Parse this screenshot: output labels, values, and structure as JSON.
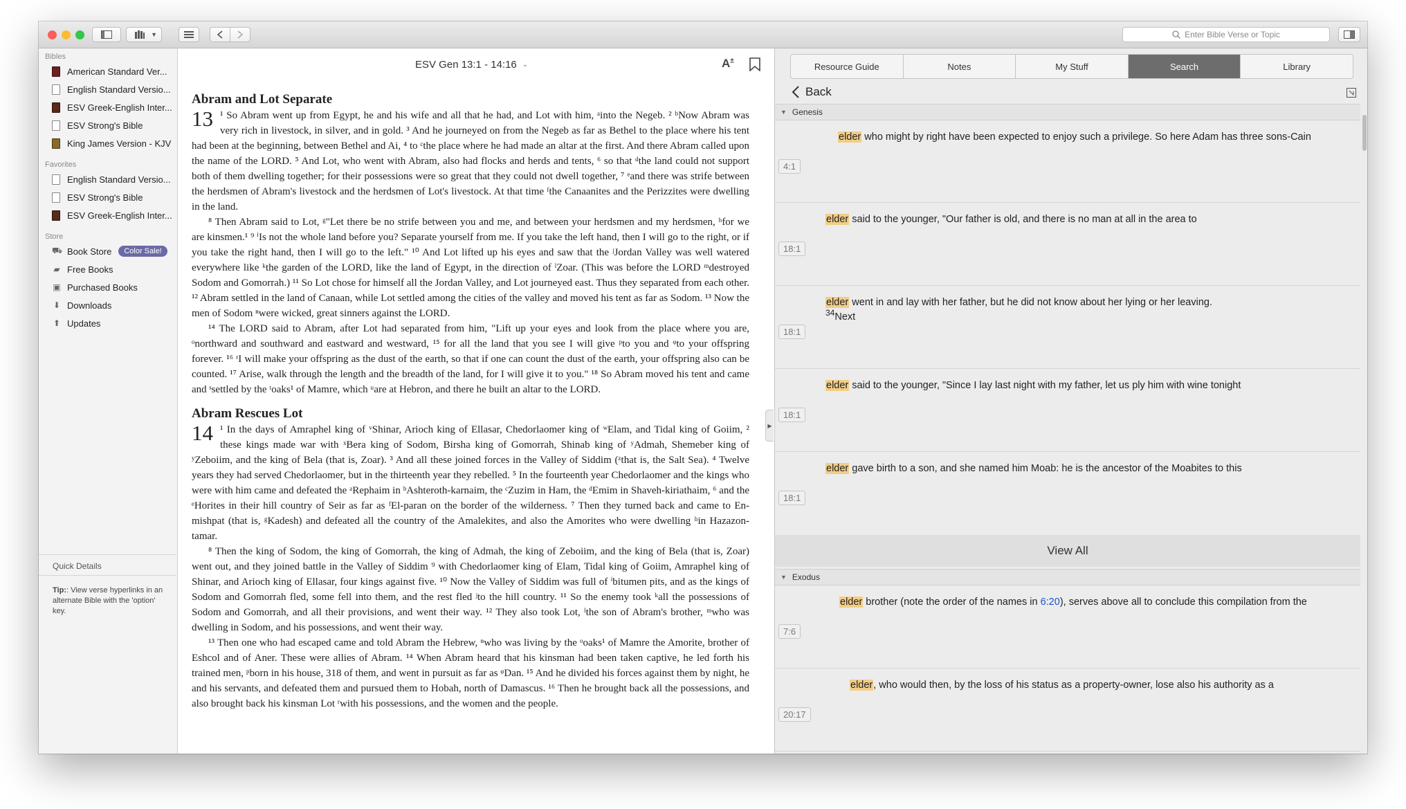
{
  "window": {
    "search_placeholder": "Enter Bible Verse or Topic",
    "traffic": [
      "#fc5f57",
      "#fdbc2e",
      "#33c748"
    ]
  },
  "sidebar": {
    "bibles_heading": "Bibles",
    "bibles": [
      {
        "label": "American Standard Ver...",
        "color": "#6e1f1f"
      },
      {
        "label": "English Standard Versio...",
        "color": "#ffffff"
      },
      {
        "label": "ESV Greek-English Inter...",
        "color": "#5a2a1a"
      },
      {
        "label": "ESV Strong's Bible",
        "color": "#ffffff"
      },
      {
        "label": "King James Version - KJV",
        "color": "#8a6a2a"
      }
    ],
    "favorites_heading": "Favorites",
    "favorites": [
      {
        "label": "English Standard Versio...",
        "color": "#ffffff"
      },
      {
        "label": "ESV Strong's Bible",
        "color": "#ffffff"
      },
      {
        "label": "ESV Greek-English Inter...",
        "color": "#5a2a1a"
      }
    ],
    "store_heading": "Store",
    "store": [
      {
        "label": "Book Store",
        "icon": "cart-icon"
      },
      {
        "label": "Free Books",
        "icon": "tag-icon"
      },
      {
        "label": "Purchased Books",
        "icon": "bag-icon"
      },
      {
        "label": "Downloads",
        "icon": "download-icon"
      },
      {
        "label": "Updates",
        "icon": "upload-icon"
      }
    ],
    "badge": "Color Sale!",
    "quick_details": "Quick Details",
    "tip_label": "Tip:",
    "tip_text": ": View verse hyperlinks in an alternate Bible with the 'option' key."
  },
  "main": {
    "reference": "ESV Gen 13:1 - 14:16",
    "heading1": "Abram and Lot Separate",
    "chapter1": "13",
    "heading2": "Abram Rescues Lot",
    "chapter2": "14"
  },
  "right": {
    "tabs": [
      "Resource Guide",
      "Notes",
      "My Stuff",
      "Search",
      "Library"
    ],
    "active_tab": "Search",
    "back_label": "Back",
    "group1": "Genesis",
    "group2": "Exodus",
    "view_all": "View All",
    "highlight_color": "#f2cd86",
    "results1": [
      {
        "hl": "elder",
        "rest": " who might by right have been expected to enjoy such a privilege. So here Adam has three sons-Cain",
        "ref": "4:1"
      },
      {
        "hl": "elder",
        "rest": " said to the younger, \"Our father is old, and there is no man at all in the area to",
        "ref": "18:1"
      },
      {
        "hl": "elder",
        "rest": " went in and lay with her father, but he did not know about her lying or her leaving.",
        "sup": "34",
        "next": "Next",
        "ref": "18:1"
      },
      {
        "hl": "elder",
        "rest": " said to the younger, \"Since I lay last night with my father, let us ply him with wine tonight",
        "ref": "18:1"
      },
      {
        "hl": "elder",
        "rest": " gave birth to a son, and she named him Moab: he is the ancestor of the Moabites to this",
        "ref": "18:1"
      }
    ],
    "results2": [
      {
        "hl": "elder",
        "pre": " brother (note the order of the names in ",
        "link": "6:20",
        "post": "), serves above all to conclude this compilation from the",
        "ref": "7:6"
      },
      {
        "hl": "elder",
        "rest": ", who would then, by the loss of his status as a property-owner, lose also his authority as a",
        "ref": "20:17"
      }
    ]
  },
  "text": {
    "p1": "¹ So Abram went up from Egypt, he and his wife and all that he had, and Lot with him, ᵃinto the Negeb. ² ᵇNow Abram was very rich in livestock, in silver, and in gold. ³ And he journeyed on from the Negeb as far as Bethel to the place where his tent had been at the beginning, between Bethel and Ai, ⁴ to ᶜthe place where he had made an altar at the first. And there Abram called upon the name of the LORD. ⁵ And Lot, who went with Abram, also had flocks and herds and tents, ⁶ so that ᵈthe land could not support both of them dwelling together; for their possessions were so great that they could not dwell together, ⁷ ᵉand there was strife between the herdsmen of Abram's livestock and the herdsmen of Lot's livestock. At that time ᶠthe Canaanites and the Perizzites were dwelling in the land.",
    "p2": "⁸ Then Abram said to Lot, ᵍ\"Let there be no strife between you and me, and between your herdsmen and my herdsmen, ʰfor we are kinsmen.¹ ⁹ ⁱIs not the whole land before you? Separate yourself from me. If you take the left hand, then I will go to the right, or if you take the right hand, then I will go to the left.\" ¹⁰ And Lot lifted up his eyes and saw that the ʲJordan Valley was well watered everywhere like ᵏthe garden of the LORD, like the land of Egypt, in the direction of ˡZoar. (This was before the LORD ᵐdestroyed Sodom and Gomorrah.) ¹¹ So Lot chose for himself all the Jordan Valley, and Lot journeyed east. Thus they separated from each other. ¹² Abram settled in the land of Canaan, while Lot settled among the cities of the valley and moved his tent as far as Sodom. ¹³ Now the men of Sodom ⁿwere wicked, great sinners against the LORD.",
    "p3": "¹⁴ The LORD said to Abram, after Lot had separated from him, \"Lift up your eyes and look from the place where you are, ᵒnorthward and southward and eastward and westward, ¹⁵ for all the land that you see I will give ᵖto you and ᵠto your offspring forever. ¹⁶ ʳI will make your offspring as the dust of the earth, so that if one can count the dust of the earth, your offspring also can be counted. ¹⁷ Arise, walk through the length and the breadth of the land, for I will give it to you.\" ¹⁸ So Abram moved his tent and came and ˢsettled by the ᵗoaks¹ of Mamre, which ᵘare at Hebron, and there he built an altar to the LORD.",
    "p4": "¹ In the days of Amraphel king of ᵛShinar, Arioch king of Ellasar, Chedorlaomer king of ʷElam, and Tidal king of Goiim, ² these kings made war with ˣBera king of Sodom, Birsha king of Gomorrah, Shinab king of ʸAdmah, Shemeber king of ʸZeboiim, and the king of Bela (that is, Zoar). ³ And all these joined forces in the Valley of Siddim (ᶻthat is, the Salt Sea). ⁴ Twelve years they had served Chedorlaomer, but in the thirteenth year they rebelled. ⁵ In the fourteenth year Chedorlaomer and the kings who were with him came and defeated the ᵃRephaim in ᵇAshteroth-karnaim, the ᶜZuzim in Ham, the ᵈEmim in Shaveh-kiriathaim, ⁶ and the ᵉHorites in their hill country of Seir as far as ᶠEl-paran on the border of the wilderness. ⁷ Then they turned back and came to En-mishpat (that is, ᵍKadesh) and defeated all the country of the Amalekites, and also the Amorites who were dwelling ʰin Hazazon-tamar.",
    "p5": "⁸ Then the king of Sodom, the king of Gomorrah, the king of Admah, the king of Zeboiim, and the king of Bela (that is, Zoar) went out, and they joined battle in the Valley of Siddim ⁹ with Chedorlaomer king of Elam, Tidal king of Goiim, Amraphel king of Shinar, and Arioch king of Ellasar, four kings against five. ¹⁰ Now the Valley of Siddim was full of ⁱbitumen pits, and as the kings of Sodom and Gomorrah fled, some fell into them, and the rest fled ʲto the hill country. ¹¹ So the enemy took ᵏall the possessions of Sodom and Gomorrah, and all their provisions, and went their way. ¹² They also took Lot, ˡthe son of Abram's brother, ᵐwho was dwelling in Sodom, and his possessions, and went their way.",
    "p6": "¹³ Then one who had escaped came and told Abram the Hebrew, ⁿwho was living by the ᵒoaks¹ of Mamre the Amorite, brother of Eshcol and of Aner. These were allies of Abram. ¹⁴ When Abram heard that his kinsman had been taken captive, he led forth his trained men, ᵖborn in his house, 318 of them, and went in pursuit as far as ᵠDan. ¹⁵ And he divided his forces against them by night, he and his servants, and defeated them and pursued them to Hobah, north of Damascus. ¹⁶ Then he brought back all the possessions, and also brought back his kinsman Lot ʳwith his possessions, and the women and the people."
  }
}
